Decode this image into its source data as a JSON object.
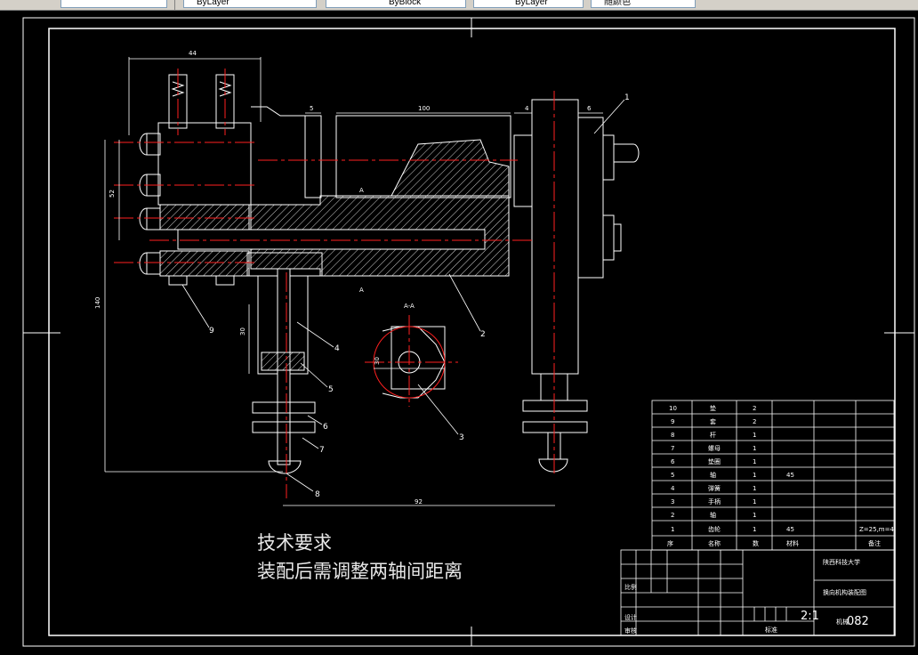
{
  "toolbar": {
    "layer_value": "ByLayer",
    "linetype_value": "ByBlock",
    "lineweight_value": "ByLayer",
    "color_value": "随颜色"
  },
  "dimensions": {
    "d44": "44",
    "d5": "5",
    "d100": "100",
    "d4": "4",
    "d6": "6",
    "d52": "52",
    "d140": "140",
    "d30": "30",
    "d92": "92",
    "d30b": "30"
  },
  "section_labels": {
    "a_top": "A-A",
    "a_marker": "A",
    "a_marker2": "A"
  },
  "balloons": [
    "1",
    "2",
    "3",
    "4",
    "5",
    "6",
    "7",
    "8",
    "9"
  ],
  "technical_requirements": {
    "heading": "技术要求",
    "line1": "装配后需调整两轴间距离"
  },
  "parts_list": [
    {
      "no": "10",
      "name": "垫",
      "qty": "2",
      "mat": ""
    },
    {
      "no": "9",
      "name": "套",
      "qty": "2",
      "mat": ""
    },
    {
      "no": "8",
      "name": "杆",
      "qty": "1",
      "mat": ""
    },
    {
      "no": "7",
      "name": "螺母",
      "qty": "1",
      "mat": ""
    },
    {
      "no": "6",
      "name": "垫圈",
      "qty": "1",
      "mat": ""
    },
    {
      "no": "5",
      "name": "轴",
      "qty": "1",
      "mat": "45"
    },
    {
      "no": "4",
      "name": "弹簧",
      "qty": "1",
      "mat": ""
    },
    {
      "no": "3",
      "name": "手柄",
      "qty": "1",
      "mat": ""
    },
    {
      "no": "2",
      "name": "轴",
      "qty": "1",
      "mat": ""
    },
    {
      "no": "1",
      "name": "齿轮",
      "qty": "1",
      "mat": "45"
    }
  ],
  "parts_header": {
    "no": "序",
    "name": "名称",
    "qty": "数",
    "mat": "材料",
    "note": "备注"
  },
  "gear_spec": "Z=25,m=4",
  "title_block": {
    "school": "陕西科技大学",
    "drawing_name": "换向机构装配图",
    "scale": "2:1",
    "drawing_no": "082",
    "drawing_no_prefix": "机械",
    "design_label": "设计",
    "check_label": "审核",
    "std_label": "标准",
    "ratio_label": "比例"
  }
}
